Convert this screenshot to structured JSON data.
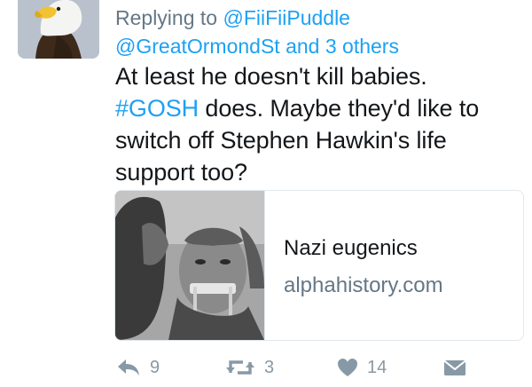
{
  "tweet": {
    "replying_prefix": "Replying to ",
    "replying_to_primary": "@FiiFiiPuddle",
    "replying_to_secondary": "@GreatOrmondSt",
    "replying_others": " and 3 others",
    "text_line1": "At least he doesn't kill babies.",
    "hashtag": "#GOSH",
    "text_after_hashtag": " does. Maybe they'd like to switch off Stephen Hawkin's life support too?"
  },
  "card": {
    "title": "Nazi eugenics",
    "domain": "alphahistory.com"
  },
  "actions": {
    "reply": {
      "icon": "reply-icon",
      "count": "9"
    },
    "retweet": {
      "icon": "retweet-icon",
      "count": "3"
    },
    "like": {
      "icon": "heart-icon",
      "count": "14"
    },
    "dm": {
      "icon": "envelope-icon"
    }
  },
  "colors": {
    "link": "#1da1f2",
    "secondary_text": "#657786",
    "icon": "#8899a6",
    "text": "#14171a",
    "border": "#e1e8ed"
  }
}
